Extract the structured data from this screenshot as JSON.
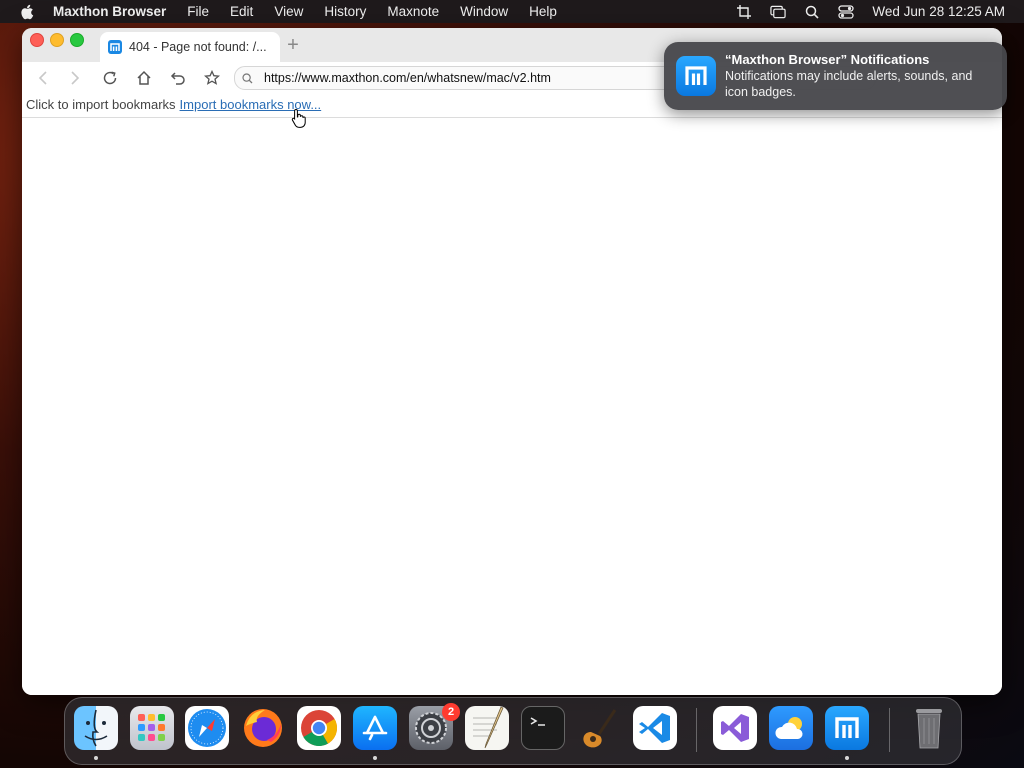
{
  "menubar": {
    "app_name": "Maxthon Browser",
    "items": [
      "File",
      "Edit",
      "View",
      "History",
      "Maxnote",
      "Window",
      "Help"
    ],
    "clock": "Wed Jun 28  12:25 AM"
  },
  "tab": {
    "title": "404 - Page not found: /...",
    "new_tab_symbol": "+"
  },
  "address": {
    "url": "https://www.maxthon.com/en/whatsnew/mac/v2.htm"
  },
  "bookmarks_bar": {
    "prompt": "Click to import bookmarks",
    "link": "Import bookmarks now..."
  },
  "notification": {
    "title": "“Maxthon Browser” Notifications",
    "body": "Notifications may include alerts, sounds, and icon badges."
  },
  "dock": {
    "settings_badge": "2",
    "apps": [
      "finder-icon",
      "launchpad-icon",
      "safari-icon",
      "firefox-icon",
      "chrome-icon",
      "app-store-icon",
      "system-settings-icon",
      "textedit-icon",
      "terminal-icon",
      "garageband-icon",
      "vscode-icon",
      "visual-studio-icon",
      "weather-icon",
      "maxthon-icon",
      "trash-icon"
    ]
  },
  "colors": {
    "accent": "#1a88e3",
    "link": "#2a6db5",
    "badge": "#ff3b30"
  }
}
